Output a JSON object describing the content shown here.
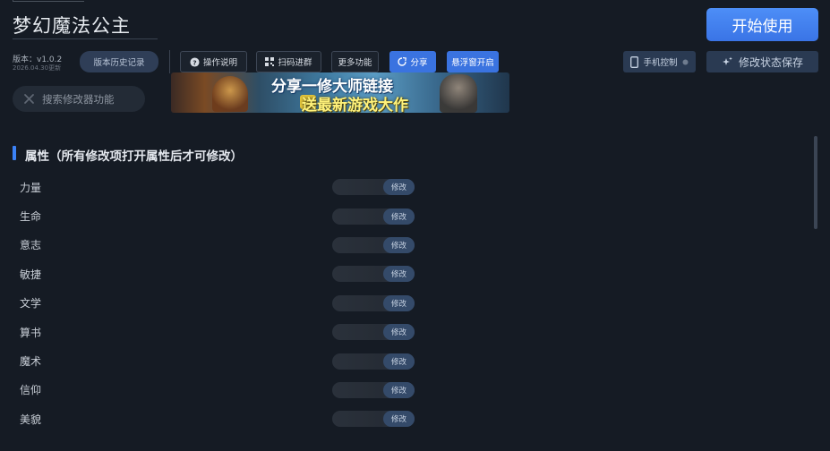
{
  "header": {
    "title": "梦幻魔法公主",
    "start_label": "开始使用",
    "version_label": "版本：v1.0.2",
    "version_date": "2026.04.30更新",
    "history_label": "版本历史记录"
  },
  "toolbar": {
    "manual_label": "操作说明",
    "scan_label": "扫码进群",
    "more_label": "更多功能",
    "share_label": "分享",
    "float_label": "悬浮窗开启",
    "phone_label": "手机控制",
    "save_label": "修改状态保存"
  },
  "search": {
    "placeholder": "搜索修改器功能"
  },
  "banner": {
    "line1": "分享一修大师链接",
    "line2": "送最新游戏大作"
  },
  "section": {
    "title": "属性（所有修改项打开属性后才可修改）"
  },
  "rows": [
    {
      "label": "力量",
      "action": "修改"
    },
    {
      "label": "生命",
      "action": "修改"
    },
    {
      "label": "意志",
      "action": "修改"
    },
    {
      "label": "敏捷",
      "action": "修改"
    },
    {
      "label": "文学",
      "action": "修改"
    },
    {
      "label": "算书",
      "action": "修改"
    },
    {
      "label": "魔术",
      "action": "修改"
    },
    {
      "label": "信仰",
      "action": "修改"
    },
    {
      "label": "美貌",
      "action": "修改"
    }
  ],
  "colors": {
    "accent": "#3b82f6",
    "background": "#151b24"
  }
}
